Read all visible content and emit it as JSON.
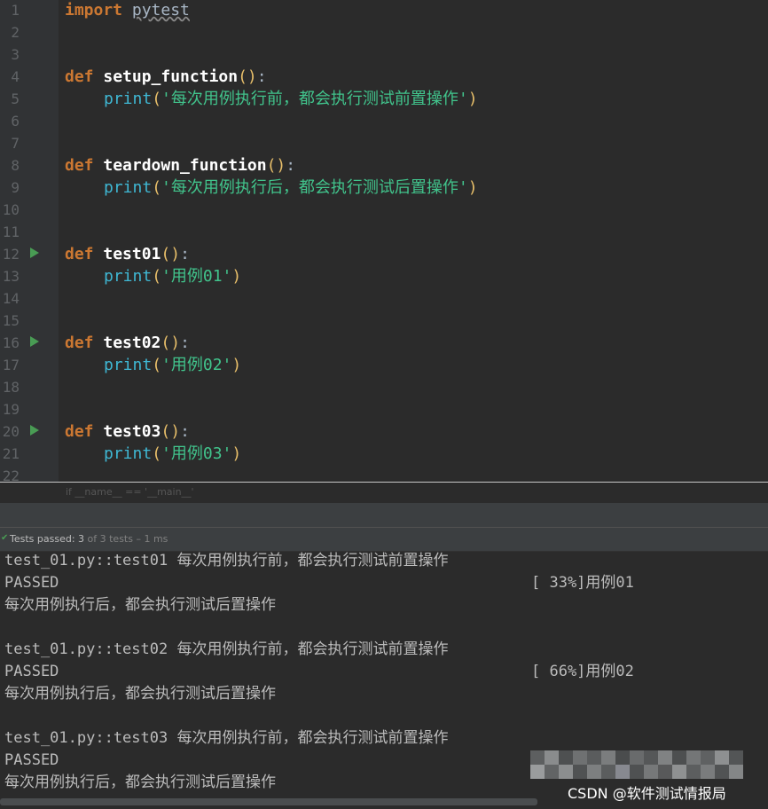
{
  "editor": {
    "line_numbers": [
      "1",
      "2",
      "3",
      "4",
      "5",
      "6",
      "7",
      "8",
      "9",
      "10",
      "11",
      "12",
      "13",
      "14",
      "15",
      "16",
      "17",
      "18",
      "19",
      "20",
      "21",
      "22"
    ],
    "code": {
      "import_kw": "import",
      "import_mod": "pytest",
      "def_kw": "def",
      "print_fn": "print",
      "setup_name": "setup_function",
      "setup_msg": "'每次用例执行前，都会执行测试前置操作'",
      "teardown_name": "teardown_function",
      "teardown_msg": "'每次用例执行后，都会执行测试后置操作'",
      "test01_name": "test01",
      "test01_msg": "'用例01'",
      "test02_name": "test02",
      "test02_msg": "'用例02'",
      "test03_name": "test03",
      "test03_msg": "'用例03'",
      "open_paren": "(",
      "close_paren": ")",
      "empty_parens": "()",
      "colon": ":"
    },
    "breadcrumb": "if __name__ == '__main__'"
  },
  "run_panel": {
    "status_prefix": "Tests passed: 3",
    "status_suffix": " of 3 tests – 1 ms",
    "console": {
      "t1_header": "test_01.py::test01 每次用例执行前，都会执行测试前置操作",
      "t2_header": "test_01.py::test02 每次用例执行前，都会执行测试前置操作",
      "t3_header": "test_01.py::test03 每次用例执行前，都会执行测试前置操作",
      "passed": "PASSED",
      "t1_pct": "[ 33%]用例01",
      "t2_pct": "[ 66%]用例02",
      "teardown_line": "每次用例执行后，都会执行测试后置操作"
    }
  },
  "watermark": "CSDN @软件测试情报局",
  "colors": {
    "keyword": "#cc7832",
    "string": "#41c48c",
    "builtin": "#3fb8d4",
    "run_icon": "#499c54",
    "background": "#2b2b2b"
  }
}
